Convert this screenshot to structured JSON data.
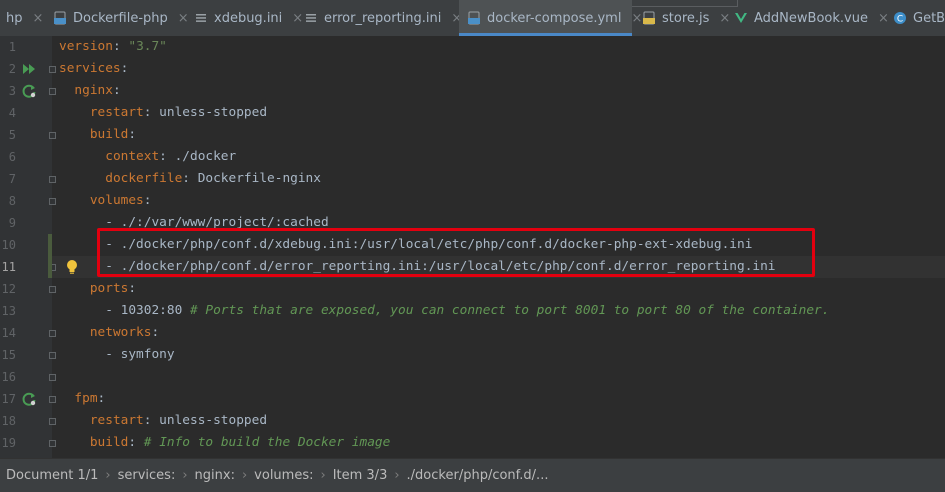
{
  "tabs": [
    {
      "label": "hp",
      "icon": "php-file-icon",
      "close": "×"
    },
    {
      "label": "Dockerfile-php",
      "icon": "docker-file-icon",
      "close": "×"
    },
    {
      "label": "xdebug.ini",
      "icon": "ini-file-icon",
      "close": "×"
    },
    {
      "label": "error_reporting.ini",
      "icon": "ini-file-icon",
      "close": "×"
    },
    {
      "label": "docker-compose.yml",
      "icon": "yaml-file-icon",
      "close": "×",
      "active": true
    },
    {
      "label": "store.js",
      "icon": "js-file-icon",
      "close": "×"
    },
    {
      "label": "AddNewBook.vue",
      "icon": "vue-file-icon",
      "close": "×"
    },
    {
      "label": "GetBo",
      "icon": "class-file-icon",
      "close": ""
    }
  ],
  "editor": {
    "file": "docker-compose.yml",
    "current_line": 11,
    "lines": [
      {
        "n": "1",
        "parts": [
          [
            "k",
            "version"
          ],
          [
            "p",
            ": "
          ],
          [
            "s",
            "\"3.7\""
          ]
        ]
      },
      {
        "n": "2",
        "parts": [
          [
            "k",
            "services"
          ],
          [
            "p",
            ":"
          ]
        ]
      },
      {
        "n": "3",
        "parts": [
          [
            "p",
            "  "
          ],
          [
            "k",
            "nginx"
          ],
          [
            "p",
            ":"
          ]
        ]
      },
      {
        "n": "4",
        "parts": [
          [
            "p",
            "    "
          ],
          [
            "k",
            "restart"
          ],
          [
            "p",
            ": unless-stopped"
          ]
        ]
      },
      {
        "n": "5",
        "parts": [
          [
            "p",
            "    "
          ],
          [
            "k",
            "build"
          ],
          [
            "p",
            ":"
          ]
        ]
      },
      {
        "n": "6",
        "parts": [
          [
            "p",
            "      "
          ],
          [
            "k",
            "context"
          ],
          [
            "p",
            ": ./docker"
          ]
        ]
      },
      {
        "n": "7",
        "parts": [
          [
            "p",
            "      "
          ],
          [
            "k",
            "dockerfile"
          ],
          [
            "p",
            ": Dockerfile-nginx"
          ]
        ]
      },
      {
        "n": "8",
        "parts": [
          [
            "p",
            "    "
          ],
          [
            "k",
            "volumes"
          ],
          [
            "p",
            ":"
          ]
        ]
      },
      {
        "n": "9",
        "parts": [
          [
            "p",
            "      - ./:/var/www/project/:cached"
          ]
        ]
      },
      {
        "n": "10",
        "parts": [
          [
            "p",
            "      - ./docker/php/conf.d/xdebug.ini:/usr/local/etc/php/conf.d/docker-php-ext-xdebug.ini"
          ]
        ]
      },
      {
        "n": "11",
        "parts": [
          [
            "p",
            "      - ./docker/php/conf.d/error_reporting.ini:/usr/local/etc/php/conf.d/error_reporting.ini"
          ]
        ]
      },
      {
        "n": "12",
        "parts": [
          [
            "p",
            "    "
          ],
          [
            "k",
            "ports"
          ],
          [
            "p",
            ":"
          ]
        ]
      },
      {
        "n": "13",
        "parts": [
          [
            "p",
            "      - 10302:80 "
          ],
          [
            "c",
            "# Ports that are exposed, you can connect to port 8001 to port 80 of the container."
          ]
        ]
      },
      {
        "n": "14",
        "parts": [
          [
            "p",
            "    "
          ],
          [
            "k",
            "networks"
          ],
          [
            "p",
            ":"
          ]
        ]
      },
      {
        "n": "15",
        "parts": [
          [
            "p",
            "      - symfony"
          ]
        ]
      },
      {
        "n": "16",
        "parts": []
      },
      {
        "n": "17",
        "parts": [
          [
            "p",
            "  "
          ],
          [
            "k",
            "fpm"
          ],
          [
            "p",
            ":"
          ]
        ]
      },
      {
        "n": "18",
        "parts": [
          [
            "p",
            "    "
          ],
          [
            "k",
            "restart"
          ],
          [
            "p",
            ": unless-stopped"
          ]
        ]
      },
      {
        "n": "19",
        "parts": [
          [
            "p",
            "    "
          ],
          [
            "k",
            "build"
          ],
          [
            "p",
            ": "
          ],
          [
            "c",
            "# Info to build the Docker image"
          ]
        ]
      }
    ]
  },
  "gutter_icons": [
    {
      "line": 2,
      "icon": "run-services-icon"
    },
    {
      "line": 3,
      "icon": "rerun-service-icon"
    },
    {
      "line": 17,
      "icon": "rerun-service-icon"
    },
    {
      "line": 11,
      "icon": "lightbulb-intention-icon"
    }
  ],
  "annotation": {
    "label": "highlighted volume mount lines",
    "color": "#e3000f"
  },
  "breadcrumb": [
    "Document 1/1",
    "services:",
    "nginx:",
    "volumes:",
    "Item 3/3",
    "./docker/php/conf.d/..."
  ],
  "colors": {
    "background": "#2b2b2b",
    "keyword": "#cc7832",
    "string": "#6a8759",
    "comment": "#629755",
    "text": "#a9b7c6"
  }
}
